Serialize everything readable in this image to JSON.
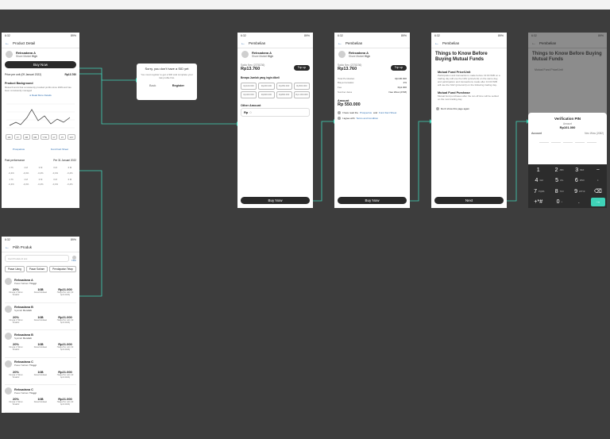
{
  "status": {
    "time": "6:32",
    "battery": "89%"
  },
  "detail": {
    "title": "Product Detail",
    "fund": {
      "name": "Reksadana A",
      "sub": "Shure Market",
      "risk": "High"
    },
    "buy": "Buy Now",
    "price_label": "Price per unit (09 Januari 2022)",
    "price": "Rp13.760",
    "bg_title": "Product Background",
    "bg_text": "Mutual Fund A that consistently provided profits since 2009 and has been consistently managed",
    "read_more": "Read More Details",
    "periods": [
      "1M",
      "1Y",
      "3M",
      "6M",
      "YTD",
      "1Y",
      "3Y",
      "10Y"
    ],
    "prospectus": "Prospektus",
    "factsheet": "Fund Fact Sheet",
    "perf_title": "Past performance",
    "perf_date": "Per 31 Januari 2022",
    "perf_rows": [
      [
        "1 Th",
        "1 M",
        "3 M",
        "3 M",
        "6 M"
      ],
      [
        "-0,4%",
        "-0,4%",
        "-0,4%",
        "-0,4%",
        "-0,4%"
      ],
      [
        "1 Th",
        "1 M",
        "3 M",
        "3 M",
        "6 M"
      ],
      [
        "-0,4%",
        "-0,4%",
        "-0,4%",
        "-0,4%",
        "-0,4%"
      ]
    ]
  },
  "dialog": {
    "title": "Sorry, you don't have a SID yet",
    "body": "You must register to get a SID and complete your risk profile first.",
    "back": "Back",
    "register": "Register"
  },
  "buy1": {
    "title": "Pembelian",
    "saldo_label": "Saldo Neo (2378236)",
    "saldo": "Rp13.760",
    "topup": "Top up",
    "how_much": "Berapa Jumlah yang ingin dibeli",
    "chips": [
      "Rp100.000",
      "Rp200.000",
      "Rp250.000",
      "Rp500.000",
      "Rp400.000",
      "Rp600.000",
      "Rp800.000",
      "Rp1.000.000"
    ],
    "other": "Other Amount",
    "rp": "Rp",
    "placeholder": "0",
    "buy": "Buy Now"
  },
  "buy2": {
    "title": "Pembelian",
    "saldo_label": "Saldo Neo (2378236)",
    "saldo": "Rp13.760",
    "topup": "Top up",
    "rows": [
      [
        "Total Pembelian",
        "Rp100.000"
      ],
      [
        "Biaya transaksi",
        "2%"
      ],
      [
        "Fee",
        "Rp1.000"
      ],
      [
        "Sumber dana",
        "Neo Wow (2728)"
      ]
    ],
    "amount_label": "Amount",
    "amount": "Rp 550.000",
    "check1_pre": "I have read the",
    "prospectus": "Prospectus",
    "and": "and",
    "factsheet": "Fund Fact Sheet",
    "check2_pre": "I agree with",
    "terms": "Terms and Condition",
    "buy": "Buy Now"
  },
  "info": {
    "title": "Pembelian",
    "heading": "Things to Know Before Buying Mutual Funds",
    "s1_title": "Mutual Fund Price/Unit",
    "s1_body": "Participation and transactions made before 13:00 WIB on a trading day will use the NAV (price/unit) on the same day, and participation and transactions made after 13:00 WIB will use the NAV (price/unit) on the following trading day.",
    "s2_title": "Mutual Fund Purchase",
    "s2_body": "Mutual fund purchases after the cut-off time will be settled on the next trading day.",
    "dont_show": "Don't show this page again",
    "next": "Next"
  },
  "pin": {
    "title": "Pembelian",
    "heading": "Things to Know Before Buying Mutual Funds",
    "sub": "Mutual Fund Price/Unit",
    "modal_title": "Verification PIN",
    "amount_label": "Amount",
    "amount": "Rp101.000",
    "account_label": "Account",
    "account": "Neo Wow (2082)",
    "keys": [
      [
        "1",
        ""
      ],
      [
        "2",
        "ABC"
      ],
      [
        "3",
        "DEF"
      ],
      [
        "4",
        "GHI"
      ],
      [
        "5",
        "JKL"
      ],
      [
        "6",
        "MNO"
      ],
      [
        "7",
        "PQRS"
      ],
      [
        "8",
        "TUV"
      ],
      [
        "9",
        "WXYZ"
      ],
      [
        "+*#",
        ""
      ],
      [
        "0",
        "+"
      ],
      [
        ".",
        ""
      ]
    ],
    "side": [
      "−",
      "·",
      "⌫",
      "→"
    ]
  },
  "list": {
    "title": "Pilih Produk",
    "search": "Cari Produk di sini",
    "filter": "Filter",
    "tabs": [
      "Pasar Uang",
      "Pasar Saham",
      "Pendapatan Tetap"
    ],
    "items": [
      {
        "name": "Reksadana A",
        "cat": "Pasar Saham",
        "risk": "Tinggi"
      },
      {
        "name": "Reksadana B",
        "cat": "Syariah",
        "risk": "Rendah"
      },
      {
        "name": "Reksadana B",
        "cat": "Syariah",
        "risk": "Rendah"
      },
      {
        "name": "Reksadana C",
        "cat": "Pasar Saham",
        "risk": "Tinggi"
      },
      {
        "name": "Reksadana C",
        "cat": "Pasar Saham",
        "risk": "Tinggi"
      }
    ],
    "ret": "20%",
    "ret_lbl": "Kinerja 1 Tahun Terakhir",
    "fund": "16B",
    "fund_lbl": "Dana Kelolaan",
    "price": "Rp21.000",
    "price_lbl": "Harga Per unit (10 April 2024)"
  }
}
